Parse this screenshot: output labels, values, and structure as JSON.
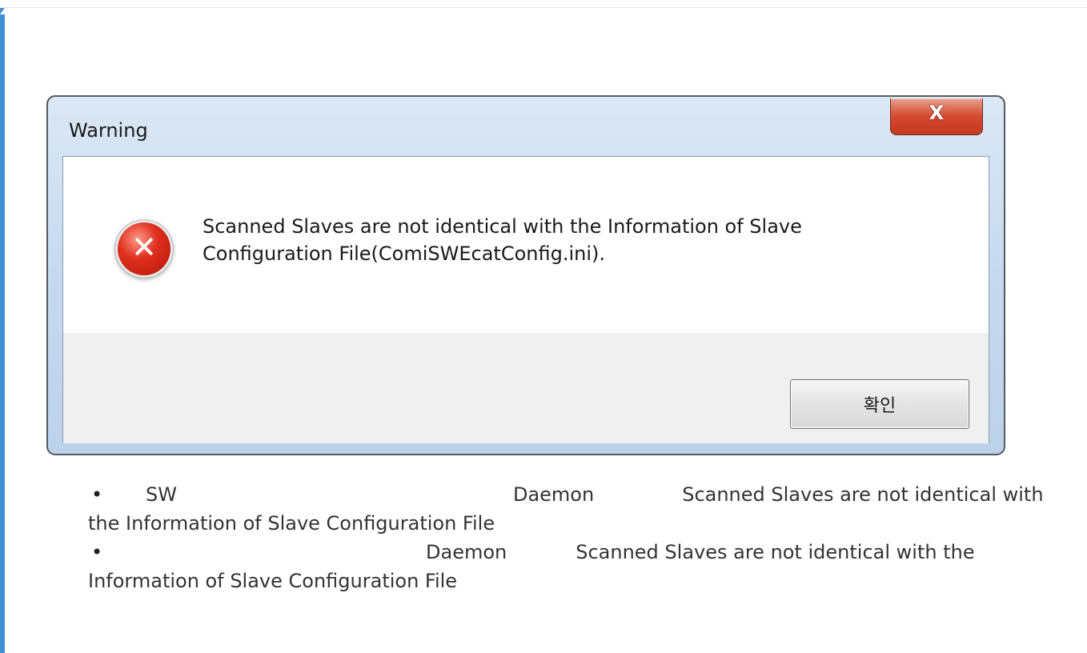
{
  "dialog": {
    "title": "Warning",
    "close_label": "X",
    "message_line1": "Scanned Slaves are not identical with the Information of Slave",
    "message_line2": "Configuration File(ComiSWEcatConfig.ini).",
    "ok_label": "확인",
    "icon": "error-icon"
  },
  "notes": [
    {
      "part1": "SW",
      "part2": "Daemon",
      "part3": "Scanned Slaves are not identical with the Information of Slave Configuration File"
    },
    {
      "part1": "Daemon",
      "part2": "Scanned Slaves are not identical with the Information of Slave Configuration File"
    }
  ],
  "colors": {
    "left_bar": "#3d8fd6",
    "close_button": "#d2492f",
    "error_icon": "#e0301e"
  }
}
